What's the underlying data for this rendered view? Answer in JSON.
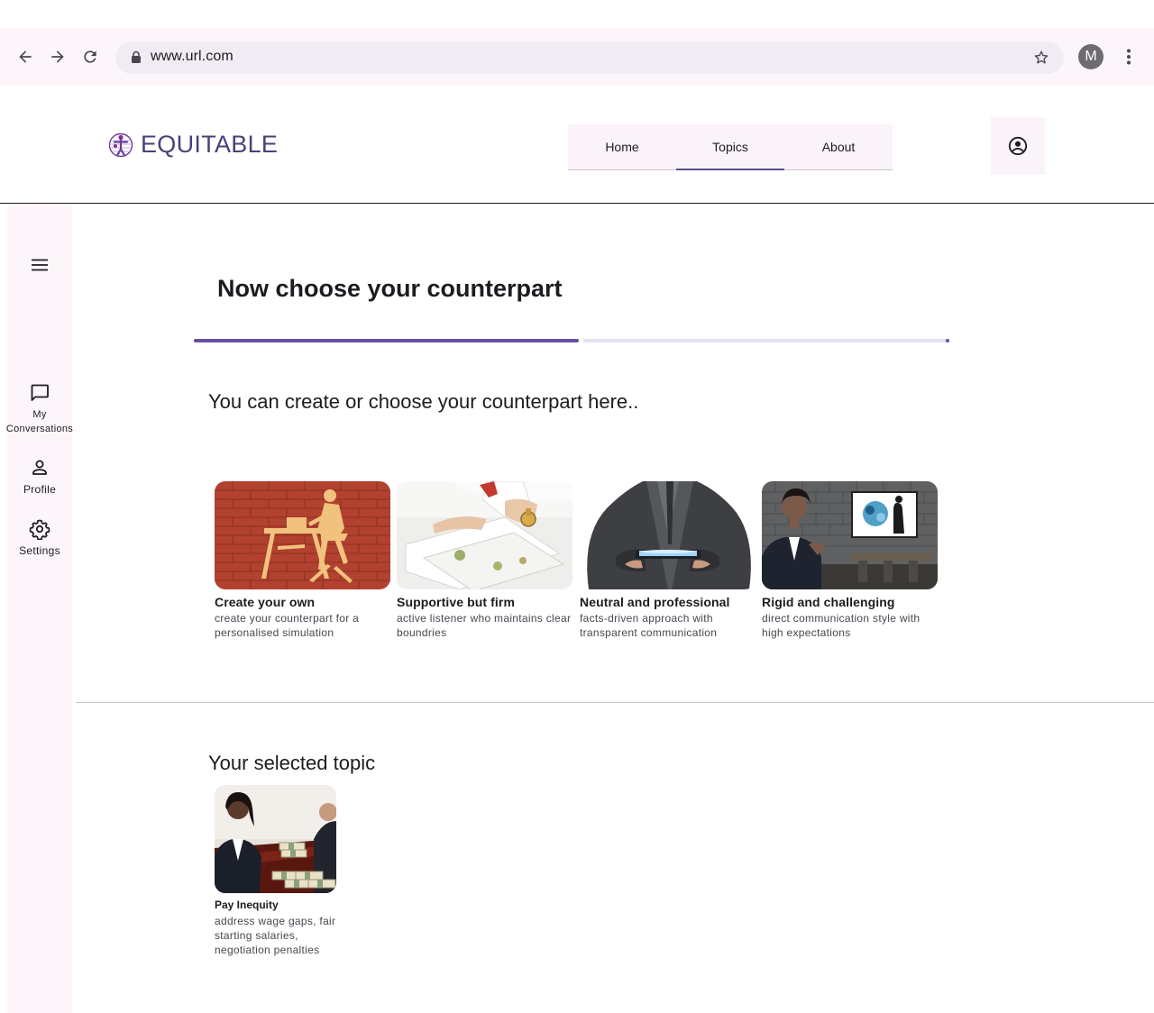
{
  "browser": {
    "url": "www.url.com",
    "profile_initial": "M"
  },
  "app": {
    "brand": "EQUITABLE",
    "nav": [
      {
        "label": "Home",
        "active": false
      },
      {
        "label": "Topics",
        "active": true
      },
      {
        "label": "About",
        "active": false
      }
    ]
  },
  "rail": {
    "items": [
      {
        "line1": "My",
        "line2": "Conversations",
        "icon": "chat-icon"
      },
      {
        "label": "Profile",
        "icon": "person-icon"
      },
      {
        "label": "Settings",
        "icon": "gear-icon"
      }
    ]
  },
  "main": {
    "title": "Now choose your counterpart",
    "progress": {
      "completed_fraction": 0.5
    },
    "subtitle": "You can create or choose your counterpart here..",
    "cards": [
      {
        "title": "Create your own",
        "desc": "create your counterpart for a personalised simulation"
      },
      {
        "title": "Supportive but firm",
        "desc": "active listener who maintains clear boundries"
      },
      {
        "title": "Neutral and professional",
        "desc": "facts-driven approach with transparent communication"
      },
      {
        "title": "Rigid and challenging",
        "desc": "direct communication style with high expectations"
      }
    ],
    "selected_heading": "Your selected topic",
    "selected_topic": {
      "title": "Pay Inequity",
      "desc": "address wage gaps, fair starting salaries, negotiation penalties"
    }
  },
  "colors": {
    "accent": "#6750a4",
    "brand_text": "#4a3f7a",
    "surface_tint": "#fcf6fb"
  }
}
